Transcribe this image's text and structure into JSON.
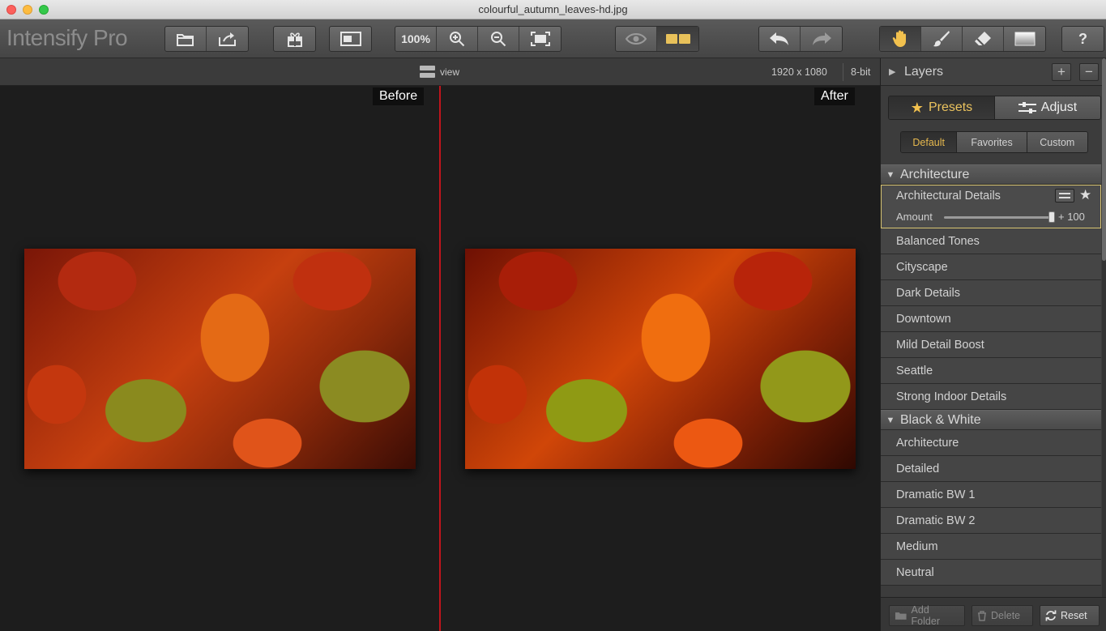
{
  "window": {
    "title": "colourful_autumn_leaves-hd.jpg"
  },
  "toolbar": {
    "logo": "Intensify Pro",
    "zoom_label": "100%",
    "icons": [
      "open-icon",
      "share-icon",
      "gift-icon",
      "single-view-icon",
      "zoom-in-icon",
      "zoom-out-icon",
      "fit-icon",
      "eye-icon",
      "split-view-icon",
      "undo-icon",
      "redo-icon",
      "hand-icon",
      "brush-icon",
      "eraser-icon",
      "gradient-icon",
      "help-icon"
    ]
  },
  "subbar": {
    "view_label": "view",
    "dimensions": "1920 x 1080",
    "bitdepth": "8-bit"
  },
  "canvas": {
    "before_label": "Before",
    "after_label": "After"
  },
  "panel": {
    "layers_title": "Layers",
    "tabs": {
      "presets": "Presets",
      "adjust": "Adjust"
    },
    "subtabs": [
      "Default",
      "Favorites",
      "Custom"
    ],
    "categories": [
      {
        "name": "Architecture",
        "selected": {
          "name": "Architectural Details",
          "amount_label": "Amount",
          "amount_value": "+ 100",
          "amount_fraction": 1.0
        },
        "items": [
          "Balanced Tones",
          "Cityscape",
          "Dark Details",
          "Downtown",
          "Mild Detail Boost",
          "Seattle",
          "Strong Indoor Details"
        ]
      },
      {
        "name": "Black & White",
        "items": [
          "Architecture",
          "Detailed",
          "Dramatic BW 1",
          "Dramatic BW 2",
          "Medium",
          "Neutral"
        ]
      }
    ],
    "bottom": {
      "add_folder": "Add Folder",
      "delete": "Delete",
      "reset": "Reset"
    }
  },
  "colors": {
    "accent": "#e7b94e",
    "divider": "#c0141c",
    "selection_border": "#d8c472"
  }
}
